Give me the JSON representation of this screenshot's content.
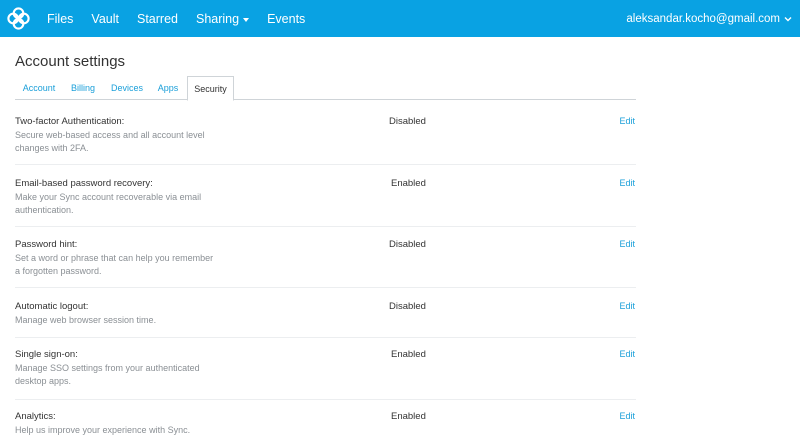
{
  "nav": {
    "items": [
      "Files",
      "Vault",
      "Starred",
      "Sharing",
      "Events"
    ],
    "user_email": "aleksandar.kocho@gmail.com"
  },
  "page_title": "Account settings",
  "tabs": [
    "Account",
    "Billing",
    "Devices",
    "Apps",
    "Security"
  ],
  "active_tab": "Security",
  "settings": [
    {
      "title": "Two-factor Authentication:",
      "desc": "Secure web-based access and all account level changes with 2FA.",
      "status": "Disabled",
      "edit": "Edit"
    },
    {
      "title": "Email-based password recovery:",
      "desc": "Make your Sync account recoverable via email authentication.",
      "status": "Enabled",
      "edit": "Edit"
    },
    {
      "title": "Password hint:",
      "desc": "Set a word or phrase that can help you remember a forgotten password.",
      "status": "Disabled",
      "edit": "Edit"
    },
    {
      "title": "Automatic logout:",
      "desc": "Manage web browser session time.",
      "status": "Disabled",
      "edit": "Edit"
    },
    {
      "title": "Single sign-on:",
      "desc": "Manage SSO settings from your authenticated desktop apps.",
      "status": "Enabled",
      "edit": "Edit"
    },
    {
      "title": "Analytics:",
      "desc": "Help us improve your experience with Sync.",
      "status": "Enabled",
      "edit": "Edit"
    }
  ],
  "colors": {
    "brand": "#09a2e3",
    "link": "#1a9fd9"
  }
}
